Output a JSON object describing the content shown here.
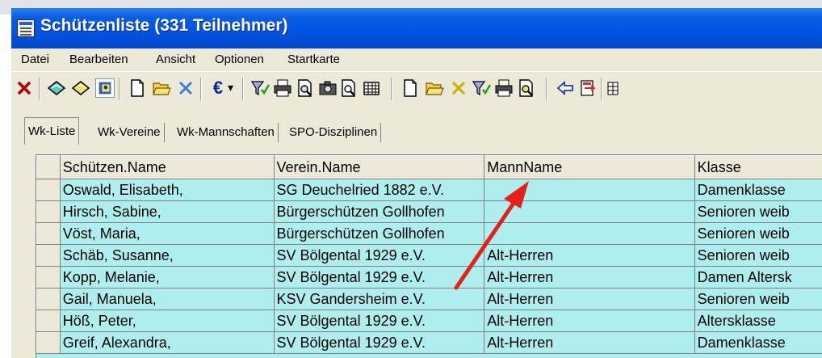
{
  "window": {
    "title": "Schützenliste (331 Teilnehmer)"
  },
  "menu": [
    "Datei",
    "Bearbeiten",
    "Ansicht",
    "Optionen",
    "Startkarte"
  ],
  "toolbar": {
    "euro_label": "€",
    "dropdown_label": "▾"
  },
  "tabs": [
    {
      "label": "Wk-Liste",
      "active": true
    },
    {
      "label": "Wk-Vereine"
    },
    {
      "label": "Wk-Mannschaften"
    },
    {
      "label": "SPO-Disziplinen"
    }
  ],
  "table": {
    "columns": [
      "Schützen.Name",
      "Verein.Name",
      "MannName",
      "Klasse"
    ],
    "rows": [
      [
        "Oswald, Elisabeth,",
        "SG Deuchelried 1882 e.V.",
        "",
        "Damenklasse"
      ],
      [
        "Hirsch, Sabine,",
        "Bürgerschützen Gollhofen",
        "",
        "Senioren weib"
      ],
      [
        "Vöst, Maria,",
        "Bürgerschützen Gollhofen",
        "",
        "Senioren weib"
      ],
      [
        "Schäb, Susanne,",
        "SV Bölgental 1929 e.V.",
        "Alt-Herren",
        "Senioren weib"
      ],
      [
        "Kopp, Melanie,",
        "SV Bölgental 1929 e.V.",
        "Alt-Herren",
        "Damen Altersk"
      ],
      [
        "Gail, Manuela,",
        "KSV Gandersheim e.V.",
        "Alt-Herren",
        "Senioren weib"
      ],
      [
        "Höß, Peter,",
        "SV Bölgental 1929 e.V.",
        "Alt-Herren",
        "Altersklasse"
      ],
      [
        "Greif, Alexandra,",
        "SV Bölgental 1929 e.V.",
        "Alt-Herren",
        "Damenklasse"
      ]
    ]
  },
  "colors": {
    "title_bar": "#0054e3",
    "grid_rows": "#afeeee",
    "annotation_arrow": "#e32219",
    "chrome": "#ece9d8"
  }
}
